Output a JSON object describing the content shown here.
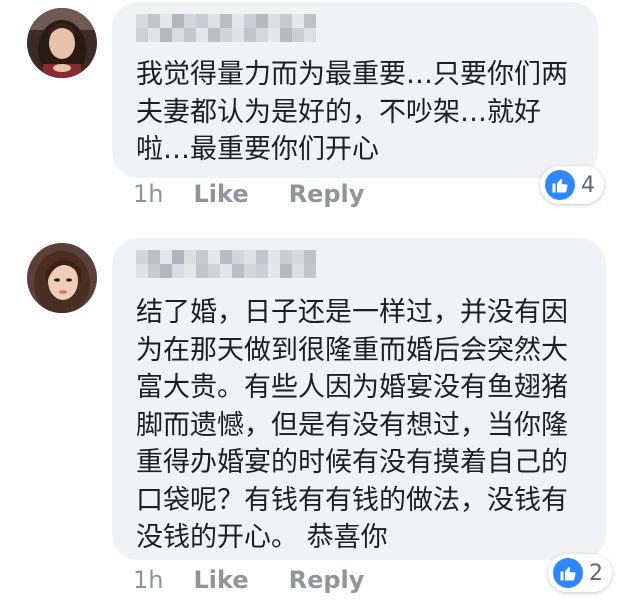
{
  "comments": [
    {
      "text": "我觉得量力而为最重要…只要你们两夫妻都认为是好的，不吵架…就好啦…最重要你们开心",
      "time": "1h",
      "like_label": "Like",
      "reply_label": "Reply",
      "reaction_count": "4",
      "reaction_icon": "thumbs-up-icon",
      "reaction_color": "#2d88ff"
    },
    {
      "text": "结了婚，日子还是一样过，并没有因为在那天做到很隆重而婚后会突然大富大贵。有些人因为婚宴没有鱼翅猪脚而遗憾，但是有没有想过，当你隆重得办婚宴的时候有没有摸着自己的口袋呢？有钱有有钱的做法，没钱有没钱的开心。 恭喜你",
      "time": "1h",
      "like_label": "Like",
      "reply_label": "Reply",
      "reaction_count": "2",
      "reaction_icon": "thumbs-up-icon",
      "reaction_color": "#2d88ff"
    }
  ],
  "colors": {
    "bubble_bg": "#f1f2f6",
    "text": "#1c1e21",
    "meta_text": "#90949c"
  }
}
